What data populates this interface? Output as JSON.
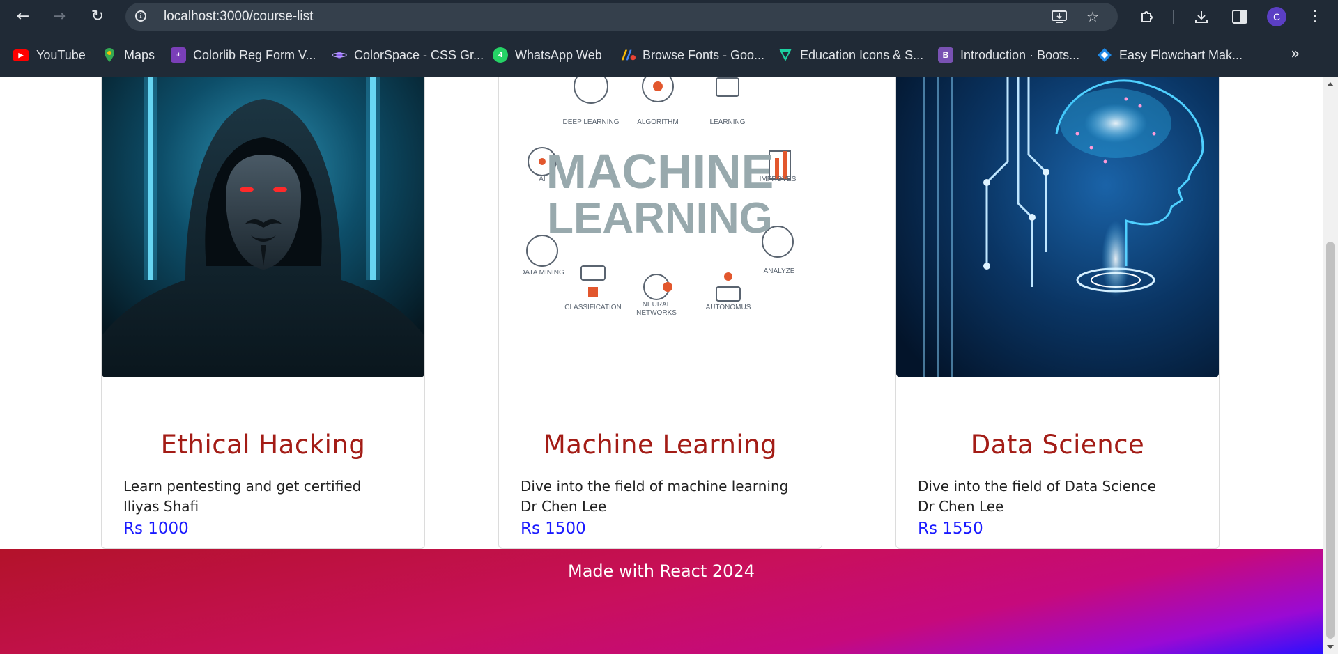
{
  "browser": {
    "url": "localhost:3000/course-list",
    "profile_initial": "C",
    "bookmarks": [
      {
        "label": "YouTube",
        "icon": "youtube-icon",
        "color": "#ff0000"
      },
      {
        "label": "Maps",
        "icon": "maps-pin-icon",
        "color": "#34a853"
      },
      {
        "label": "Colorlib Reg Form V...",
        "icon": "colorlib-icon",
        "color": "#7a3fb8"
      },
      {
        "label": "ColorSpace - CSS Gr...",
        "icon": "colorspace-planet-icon",
        "color": "#8a5cf0"
      },
      {
        "label": "WhatsApp Web",
        "icon": "whatsapp-icon",
        "color": "#25d366"
      },
      {
        "label": "Browse Fonts - Goo...",
        "icon": "google-fonts-icon",
        "color": "#4285f4"
      },
      {
        "label": "Education Icons & S...",
        "icon": "flaticon-icon",
        "color": "#1dd1a1"
      },
      {
        "label": "Introduction · Boots...",
        "icon": "bootstrap-icon",
        "color": "#7952b3"
      },
      {
        "label": "Easy Flowchart Mak...",
        "icon": "flowchart-icon",
        "color": "#1e88e5"
      }
    ]
  },
  "courses": [
    {
      "title": "Ethical Hacking",
      "description": "Learn pentesting and get certified",
      "author": "Iliyas Shafi",
      "price": "Rs 1000",
      "image": "hooded-hacker-image"
    },
    {
      "title": "Machine Learning",
      "description": "Dive into the field of machine learning",
      "author": "Dr Chen Lee",
      "price": "Rs 1500",
      "image": "machine-learning-infographic-image",
      "image_text": {
        "heading1": "MACHINE",
        "heading2": "LEARNING",
        "labels": [
          "DEEP LEARNING",
          "ALGORITHM",
          "LEARNING",
          "AI",
          "IMPROVES",
          "DATA MINING",
          "ANALYZE",
          "CLASSIFICATION",
          "NEURAL",
          "NETWORKS",
          "AUTONOMUS"
        ]
      }
    },
    {
      "title": "Data Science",
      "description": "Dive into the field of Data Science",
      "author": "Dr Chen Lee",
      "price": "Rs 1550",
      "image": "digital-brain-image"
    }
  ],
  "footer": {
    "text": "Made with React 2024"
  },
  "colors": {
    "title": "#a31c16",
    "price": "#1a1aff",
    "chrome": "#202a36"
  }
}
